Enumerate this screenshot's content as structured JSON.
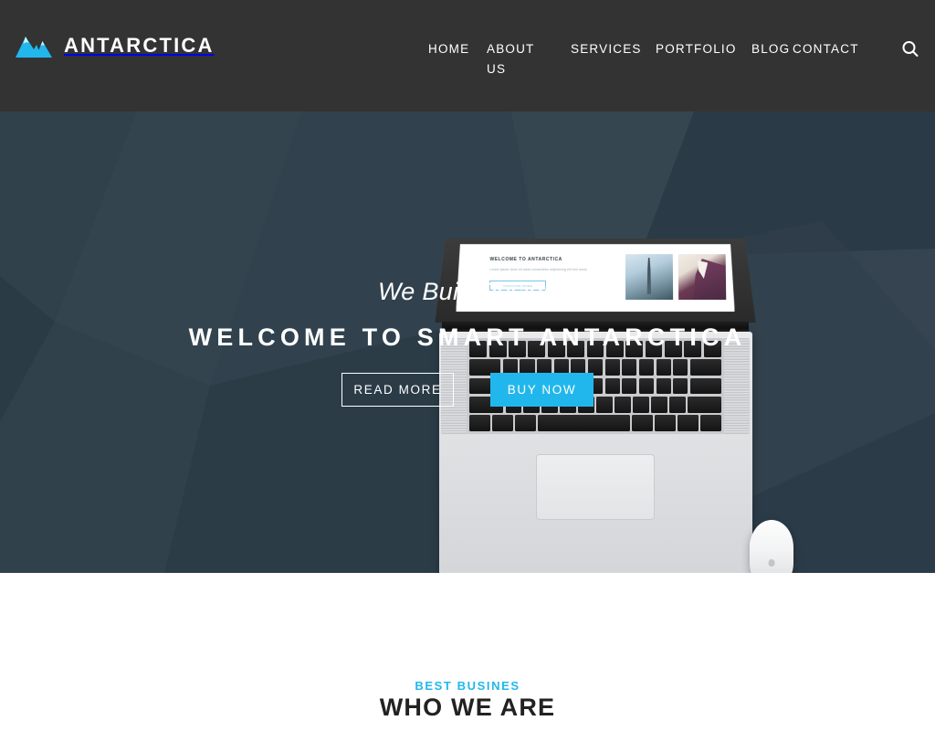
{
  "header": {
    "brand": {
      "name": "ANTARCTICA",
      "logo_icon": "mountain-icon",
      "logo_color": "#22b7ec"
    },
    "nav": [
      {
        "label": "HOME",
        "name": "home"
      },
      {
        "label": "ABOUT US",
        "name": "about-us"
      },
      {
        "label": "SERVICES",
        "name": "services"
      },
      {
        "label": "PORTFOLIO",
        "name": "portfolio"
      },
      {
        "label": "BLOG",
        "name": "blog"
      },
      {
        "label": "CONTACT",
        "name": "contact"
      }
    ],
    "search_icon": "search-icon",
    "background_color": "#333333"
  },
  "hero": {
    "subtitle": "We Built Design",
    "title": "WELCOME TO SMART ANTARCTICA",
    "primary_button": "BUY NOW",
    "secondary_button": "READ MORE",
    "background_color": "#2d3e4a",
    "accent_color": "#22b7ec",
    "device": {
      "type": "laptop-mockup",
      "screen": {
        "heading": "WELCOME TO ANTARCTICA",
        "body": "Lorem ipsum dolor sit amet consectetur adipisicing elit kon nocis",
        "button": "DISCOVER MORE",
        "images": [
          "cityscape-thumbnail",
          "portrait-thumbnail"
        ]
      },
      "accessory": "magic-mouse"
    }
  },
  "about_section": {
    "eyebrow": "BEST BUSINES",
    "title": "WHO WE ARE",
    "eyebrow_color": "#22b7ec",
    "title_color": "#222222"
  }
}
